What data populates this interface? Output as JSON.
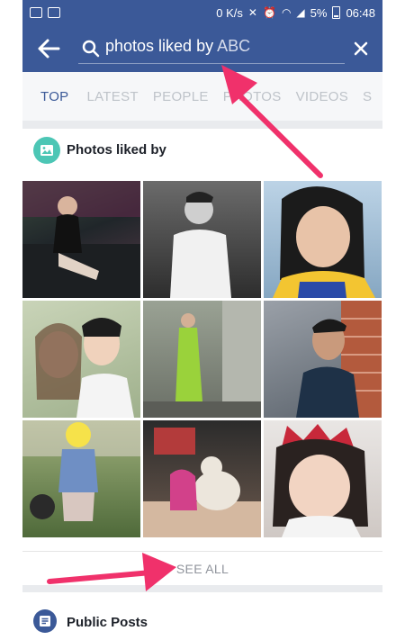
{
  "status_bar": {
    "network_speed": "0 K/s",
    "battery_percent": "5%",
    "time": "06:48"
  },
  "search": {
    "query_prefix": "photos liked by",
    "query_name": "ABC"
  },
  "tabs": [
    {
      "label": "TOP",
      "active": true
    },
    {
      "label": "LATEST",
      "active": false
    },
    {
      "label": "PEOPLE",
      "active": false
    },
    {
      "label": "PHOTOS",
      "active": false
    },
    {
      "label": "VIDEOS",
      "active": false
    },
    {
      "label": "S",
      "active": false
    }
  ],
  "photos_section": {
    "title": "Photos liked by",
    "photo_count": 9,
    "see_all_label": "SEE ALL"
  },
  "public_posts_section": {
    "title": "Public Posts"
  },
  "colors": {
    "brand": "#3b5998",
    "photos_icon": "#4cc6b5",
    "annotation_arrow": "#f0316b"
  },
  "icons": [
    "back-arrow-icon",
    "search-icon",
    "close-icon",
    "photos-icon",
    "public-posts-icon"
  ]
}
